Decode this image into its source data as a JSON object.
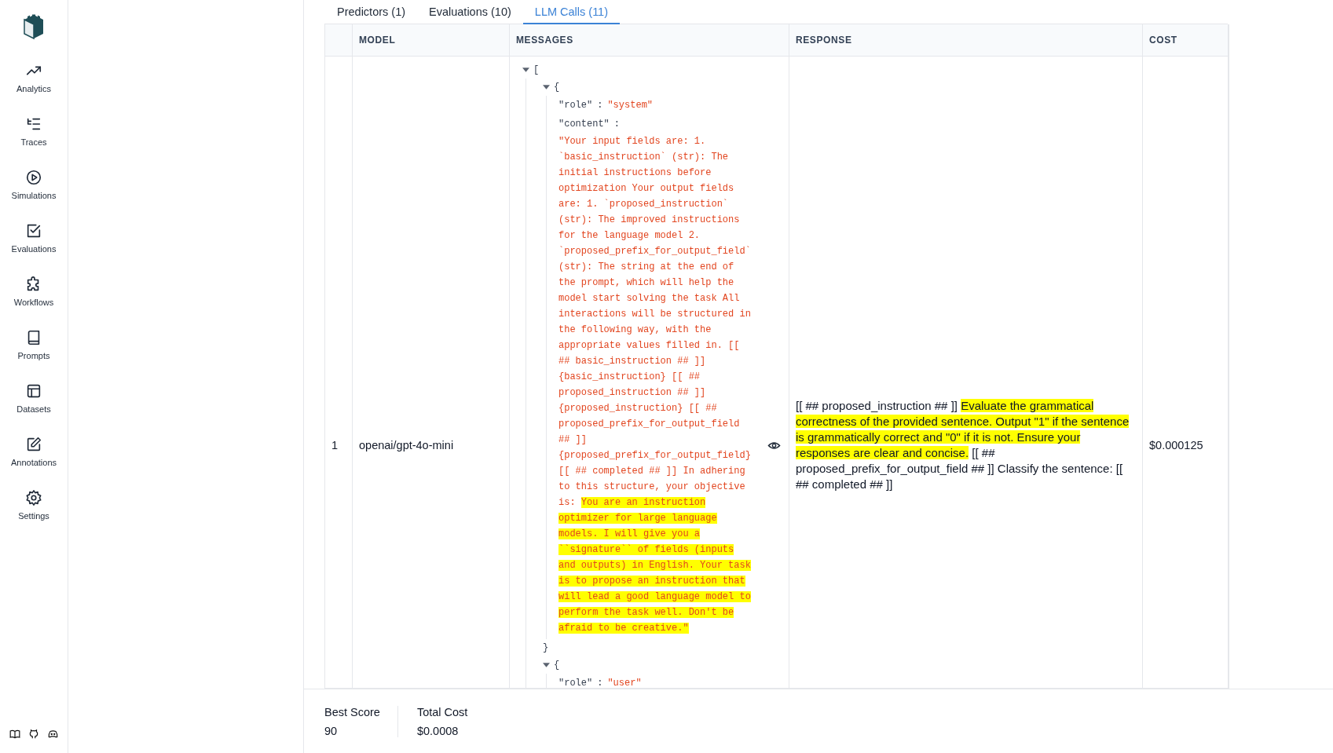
{
  "sidebar": {
    "items": [
      {
        "kind": "analytics",
        "label": "Analytics"
      },
      {
        "kind": "traces",
        "label": "Traces"
      },
      {
        "kind": "simulations",
        "label": "Simulations"
      },
      {
        "kind": "evaluations",
        "label": "Evaluations"
      },
      {
        "kind": "workflows",
        "label": "Workflows"
      },
      {
        "kind": "prompts",
        "label": "Prompts"
      },
      {
        "kind": "datasets",
        "label": "Datasets"
      },
      {
        "kind": "annotations",
        "label": "Annotations"
      },
      {
        "kind": "settings",
        "label": "Settings"
      }
    ]
  },
  "tabs": [
    {
      "label": "Predictors (1)",
      "selected": false
    },
    {
      "label": "Evaluations (10)",
      "selected": false
    },
    {
      "label": "LLM Calls (11)",
      "selected": true
    }
  ],
  "table": {
    "columns": [
      "MODEL",
      "MESSAGES",
      "RESPONSE",
      "COST"
    ],
    "rows": [
      {
        "index": "1",
        "model": "openai/gpt-4o-mini",
        "messages": {
          "open": "[",
          "expanded": true,
          "separator": ":",
          "items": [
            {
              "open": "{",
              "close": "}",
              "expanded": true,
              "fields": [
                {
                  "key": "\"role\"",
                  "kind": "inline",
                  "value": [
                    {
                      "text": "\"system\"",
                      "highlighted": false
                    }
                  ]
                },
                {
                  "key": "\"content\"",
                  "kind": "block",
                  "value": [
                    {
                      "text": "\"Your input fields are: 1. `basic_instruction` (str): The initial instructions before optimization Your output fields are: 1. `proposed_instruction` (str): The improved instructions for the language model 2. `proposed_prefix_for_output_field` (str): The string at the end of the prompt, which will help the model start solving the task All interactions will be structured in the following way, with the appropriate values filled in. [[ ## basic_instruction ## ]] {basic_instruction} [[ ## proposed_instruction ## ]] {proposed_instruction} [[ ## proposed_prefix_for_output_field ## ]] {proposed_prefix_for_output_field} [[ ## completed ## ]] In adhering to this structure, your objective is: ",
                      "highlighted": false
                    },
                    {
                      "text": "You are an instruction optimizer for large language models. I will give you a ``signature`` of fields (inputs and outputs) in English. Your task is to propose an instruction that will lead a good language model to perform the task well. Don't be afraid to be creative.\"",
                      "highlighted": true
                    }
                  ]
                }
              ]
            },
            {
              "open": "{",
              "expanded": true,
              "fields": [
                {
                  "key": "\"role\"",
                  "kind": "inline",
                  "value": [
                    {
                      "text": "\"user\"",
                      "highlighted": false
                    }
                  ]
                }
              ]
            }
          ]
        },
        "response": [
          {
            "text": "[[ ## proposed_instruction ## ]] ",
            "highlighted": false
          },
          {
            "text": "Evaluate the grammatical correctness of the provided sentence. Output \"1\" if the sentence is grammatically correct and \"0\" if it is not. Ensure your responses are clear and concise.",
            "highlighted": true
          },
          {
            "text": " [[ ## proposed_prefix_for_output_field ## ]] Classify the sentence: [[ ## completed ## ]]",
            "highlighted": false
          }
        ],
        "cost": "$0.000125"
      }
    ]
  },
  "footer": {
    "stats": [
      {
        "label": "Best Score",
        "value": "90"
      },
      {
        "label": "Total Cost",
        "value": "$0.0008"
      }
    ]
  }
}
